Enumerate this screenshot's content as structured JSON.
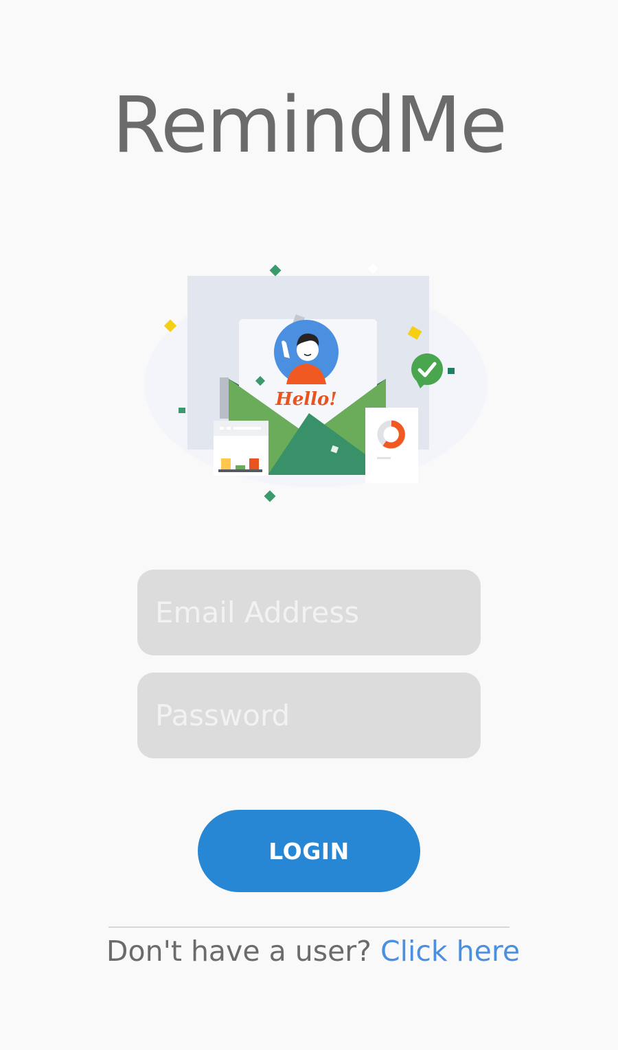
{
  "app": {
    "title": "RemindMe"
  },
  "illustration": {
    "greeting": "Hello!"
  },
  "form": {
    "email_placeholder": "Email Address",
    "email_value": "",
    "password_placeholder": "Password",
    "password_value": ""
  },
  "login": {
    "label": "LOGIN"
  },
  "signup": {
    "prompt": "Don't have a user? ",
    "link_label": "Click here"
  },
  "colors": {
    "background": "#f9f9f9",
    "title": "#6b6b6b",
    "field_background": "#dcdcdc",
    "button": "#2887d4",
    "link": "#4a8fe0"
  }
}
